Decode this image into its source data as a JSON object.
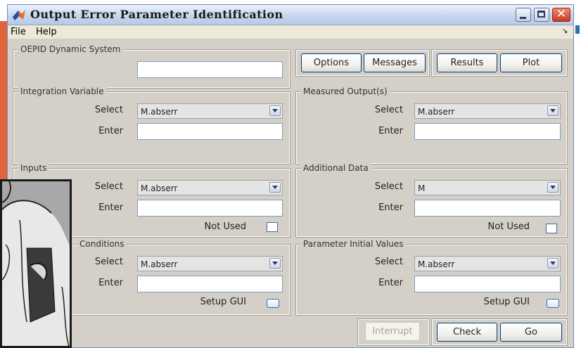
{
  "window": {
    "title": "Output Error Parameter Identification"
  },
  "menu": {
    "file": "File",
    "help": "Help"
  },
  "dynamic_system": {
    "title": "OEPID Dynamic System",
    "value": ""
  },
  "toolbar": {
    "options": "Options",
    "messages": "Messages",
    "results": "Results",
    "plot": "Plot"
  },
  "common": {
    "select": "Select",
    "enter": "Enter",
    "not_used": "Not Used",
    "setup_gui": "Setup GUI"
  },
  "integration": {
    "title": "Integration Variable",
    "selected": "M.abserr",
    "value": ""
  },
  "measured": {
    "title": "Measured Output(s)",
    "selected": "M.abserr",
    "value": ""
  },
  "inputs": {
    "title": "Inputs",
    "selected": "M.abserr",
    "value": ""
  },
  "additional": {
    "title": "Additional Data",
    "selected": "M",
    "value": ""
  },
  "initial": {
    "title": "Conditions",
    "selected": "M.abserr",
    "value": ""
  },
  "parameters": {
    "title": "Parameter Initial Values",
    "selected": "M.abserr",
    "value": ""
  },
  "actions": {
    "interrupt": "Interrupt",
    "check": "Check",
    "go": "Go"
  },
  "colors": {
    "accent_orange": "#e0643a",
    "title_blue": "#b7c9e5",
    "close_red": "#c8391f"
  }
}
